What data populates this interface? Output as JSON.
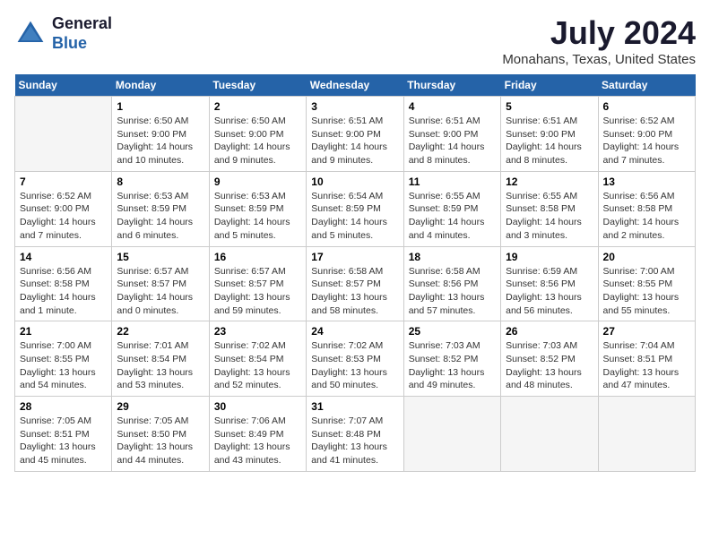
{
  "header": {
    "logo_line1": "General",
    "logo_line2": "Blue",
    "title": "July 2024",
    "subtitle": "Monahans, Texas, United States"
  },
  "weekdays": [
    "Sunday",
    "Monday",
    "Tuesday",
    "Wednesday",
    "Thursday",
    "Friday",
    "Saturday"
  ],
  "weeks": [
    [
      {
        "day": "",
        "empty": true
      },
      {
        "day": "1",
        "details": "Sunrise: 6:50 AM\nSunset: 9:00 PM\nDaylight: 14 hours\nand 10 minutes."
      },
      {
        "day": "2",
        "details": "Sunrise: 6:50 AM\nSunset: 9:00 PM\nDaylight: 14 hours\nand 9 minutes."
      },
      {
        "day": "3",
        "details": "Sunrise: 6:51 AM\nSunset: 9:00 PM\nDaylight: 14 hours\nand 9 minutes."
      },
      {
        "day": "4",
        "details": "Sunrise: 6:51 AM\nSunset: 9:00 PM\nDaylight: 14 hours\nand 8 minutes."
      },
      {
        "day": "5",
        "details": "Sunrise: 6:51 AM\nSunset: 9:00 PM\nDaylight: 14 hours\nand 8 minutes."
      },
      {
        "day": "6",
        "details": "Sunrise: 6:52 AM\nSunset: 9:00 PM\nDaylight: 14 hours\nand 7 minutes."
      }
    ],
    [
      {
        "day": "7",
        "details": "Sunrise: 6:52 AM\nSunset: 9:00 PM\nDaylight: 14 hours\nand 7 minutes."
      },
      {
        "day": "8",
        "details": "Sunrise: 6:53 AM\nSunset: 8:59 PM\nDaylight: 14 hours\nand 6 minutes."
      },
      {
        "day": "9",
        "details": "Sunrise: 6:53 AM\nSunset: 8:59 PM\nDaylight: 14 hours\nand 5 minutes."
      },
      {
        "day": "10",
        "details": "Sunrise: 6:54 AM\nSunset: 8:59 PM\nDaylight: 14 hours\nand 5 minutes."
      },
      {
        "day": "11",
        "details": "Sunrise: 6:55 AM\nSunset: 8:59 PM\nDaylight: 14 hours\nand 4 minutes."
      },
      {
        "day": "12",
        "details": "Sunrise: 6:55 AM\nSunset: 8:58 PM\nDaylight: 14 hours\nand 3 minutes."
      },
      {
        "day": "13",
        "details": "Sunrise: 6:56 AM\nSunset: 8:58 PM\nDaylight: 14 hours\nand 2 minutes."
      }
    ],
    [
      {
        "day": "14",
        "details": "Sunrise: 6:56 AM\nSunset: 8:58 PM\nDaylight: 14 hours\nand 1 minute."
      },
      {
        "day": "15",
        "details": "Sunrise: 6:57 AM\nSunset: 8:57 PM\nDaylight: 14 hours\nand 0 minutes."
      },
      {
        "day": "16",
        "details": "Sunrise: 6:57 AM\nSunset: 8:57 PM\nDaylight: 13 hours\nand 59 minutes."
      },
      {
        "day": "17",
        "details": "Sunrise: 6:58 AM\nSunset: 8:57 PM\nDaylight: 13 hours\nand 58 minutes."
      },
      {
        "day": "18",
        "details": "Sunrise: 6:58 AM\nSunset: 8:56 PM\nDaylight: 13 hours\nand 57 minutes."
      },
      {
        "day": "19",
        "details": "Sunrise: 6:59 AM\nSunset: 8:56 PM\nDaylight: 13 hours\nand 56 minutes."
      },
      {
        "day": "20",
        "details": "Sunrise: 7:00 AM\nSunset: 8:55 PM\nDaylight: 13 hours\nand 55 minutes."
      }
    ],
    [
      {
        "day": "21",
        "details": "Sunrise: 7:00 AM\nSunset: 8:55 PM\nDaylight: 13 hours\nand 54 minutes."
      },
      {
        "day": "22",
        "details": "Sunrise: 7:01 AM\nSunset: 8:54 PM\nDaylight: 13 hours\nand 53 minutes."
      },
      {
        "day": "23",
        "details": "Sunrise: 7:02 AM\nSunset: 8:54 PM\nDaylight: 13 hours\nand 52 minutes."
      },
      {
        "day": "24",
        "details": "Sunrise: 7:02 AM\nSunset: 8:53 PM\nDaylight: 13 hours\nand 50 minutes."
      },
      {
        "day": "25",
        "details": "Sunrise: 7:03 AM\nSunset: 8:52 PM\nDaylight: 13 hours\nand 49 minutes."
      },
      {
        "day": "26",
        "details": "Sunrise: 7:03 AM\nSunset: 8:52 PM\nDaylight: 13 hours\nand 48 minutes."
      },
      {
        "day": "27",
        "details": "Sunrise: 7:04 AM\nSunset: 8:51 PM\nDaylight: 13 hours\nand 47 minutes."
      }
    ],
    [
      {
        "day": "28",
        "details": "Sunrise: 7:05 AM\nSunset: 8:51 PM\nDaylight: 13 hours\nand 45 minutes."
      },
      {
        "day": "29",
        "details": "Sunrise: 7:05 AM\nSunset: 8:50 PM\nDaylight: 13 hours\nand 44 minutes."
      },
      {
        "day": "30",
        "details": "Sunrise: 7:06 AM\nSunset: 8:49 PM\nDaylight: 13 hours\nand 43 minutes."
      },
      {
        "day": "31",
        "details": "Sunrise: 7:07 AM\nSunset: 8:48 PM\nDaylight: 13 hours\nand 41 minutes."
      },
      {
        "day": "",
        "empty": true
      },
      {
        "day": "",
        "empty": true
      },
      {
        "day": "",
        "empty": true
      }
    ]
  ]
}
